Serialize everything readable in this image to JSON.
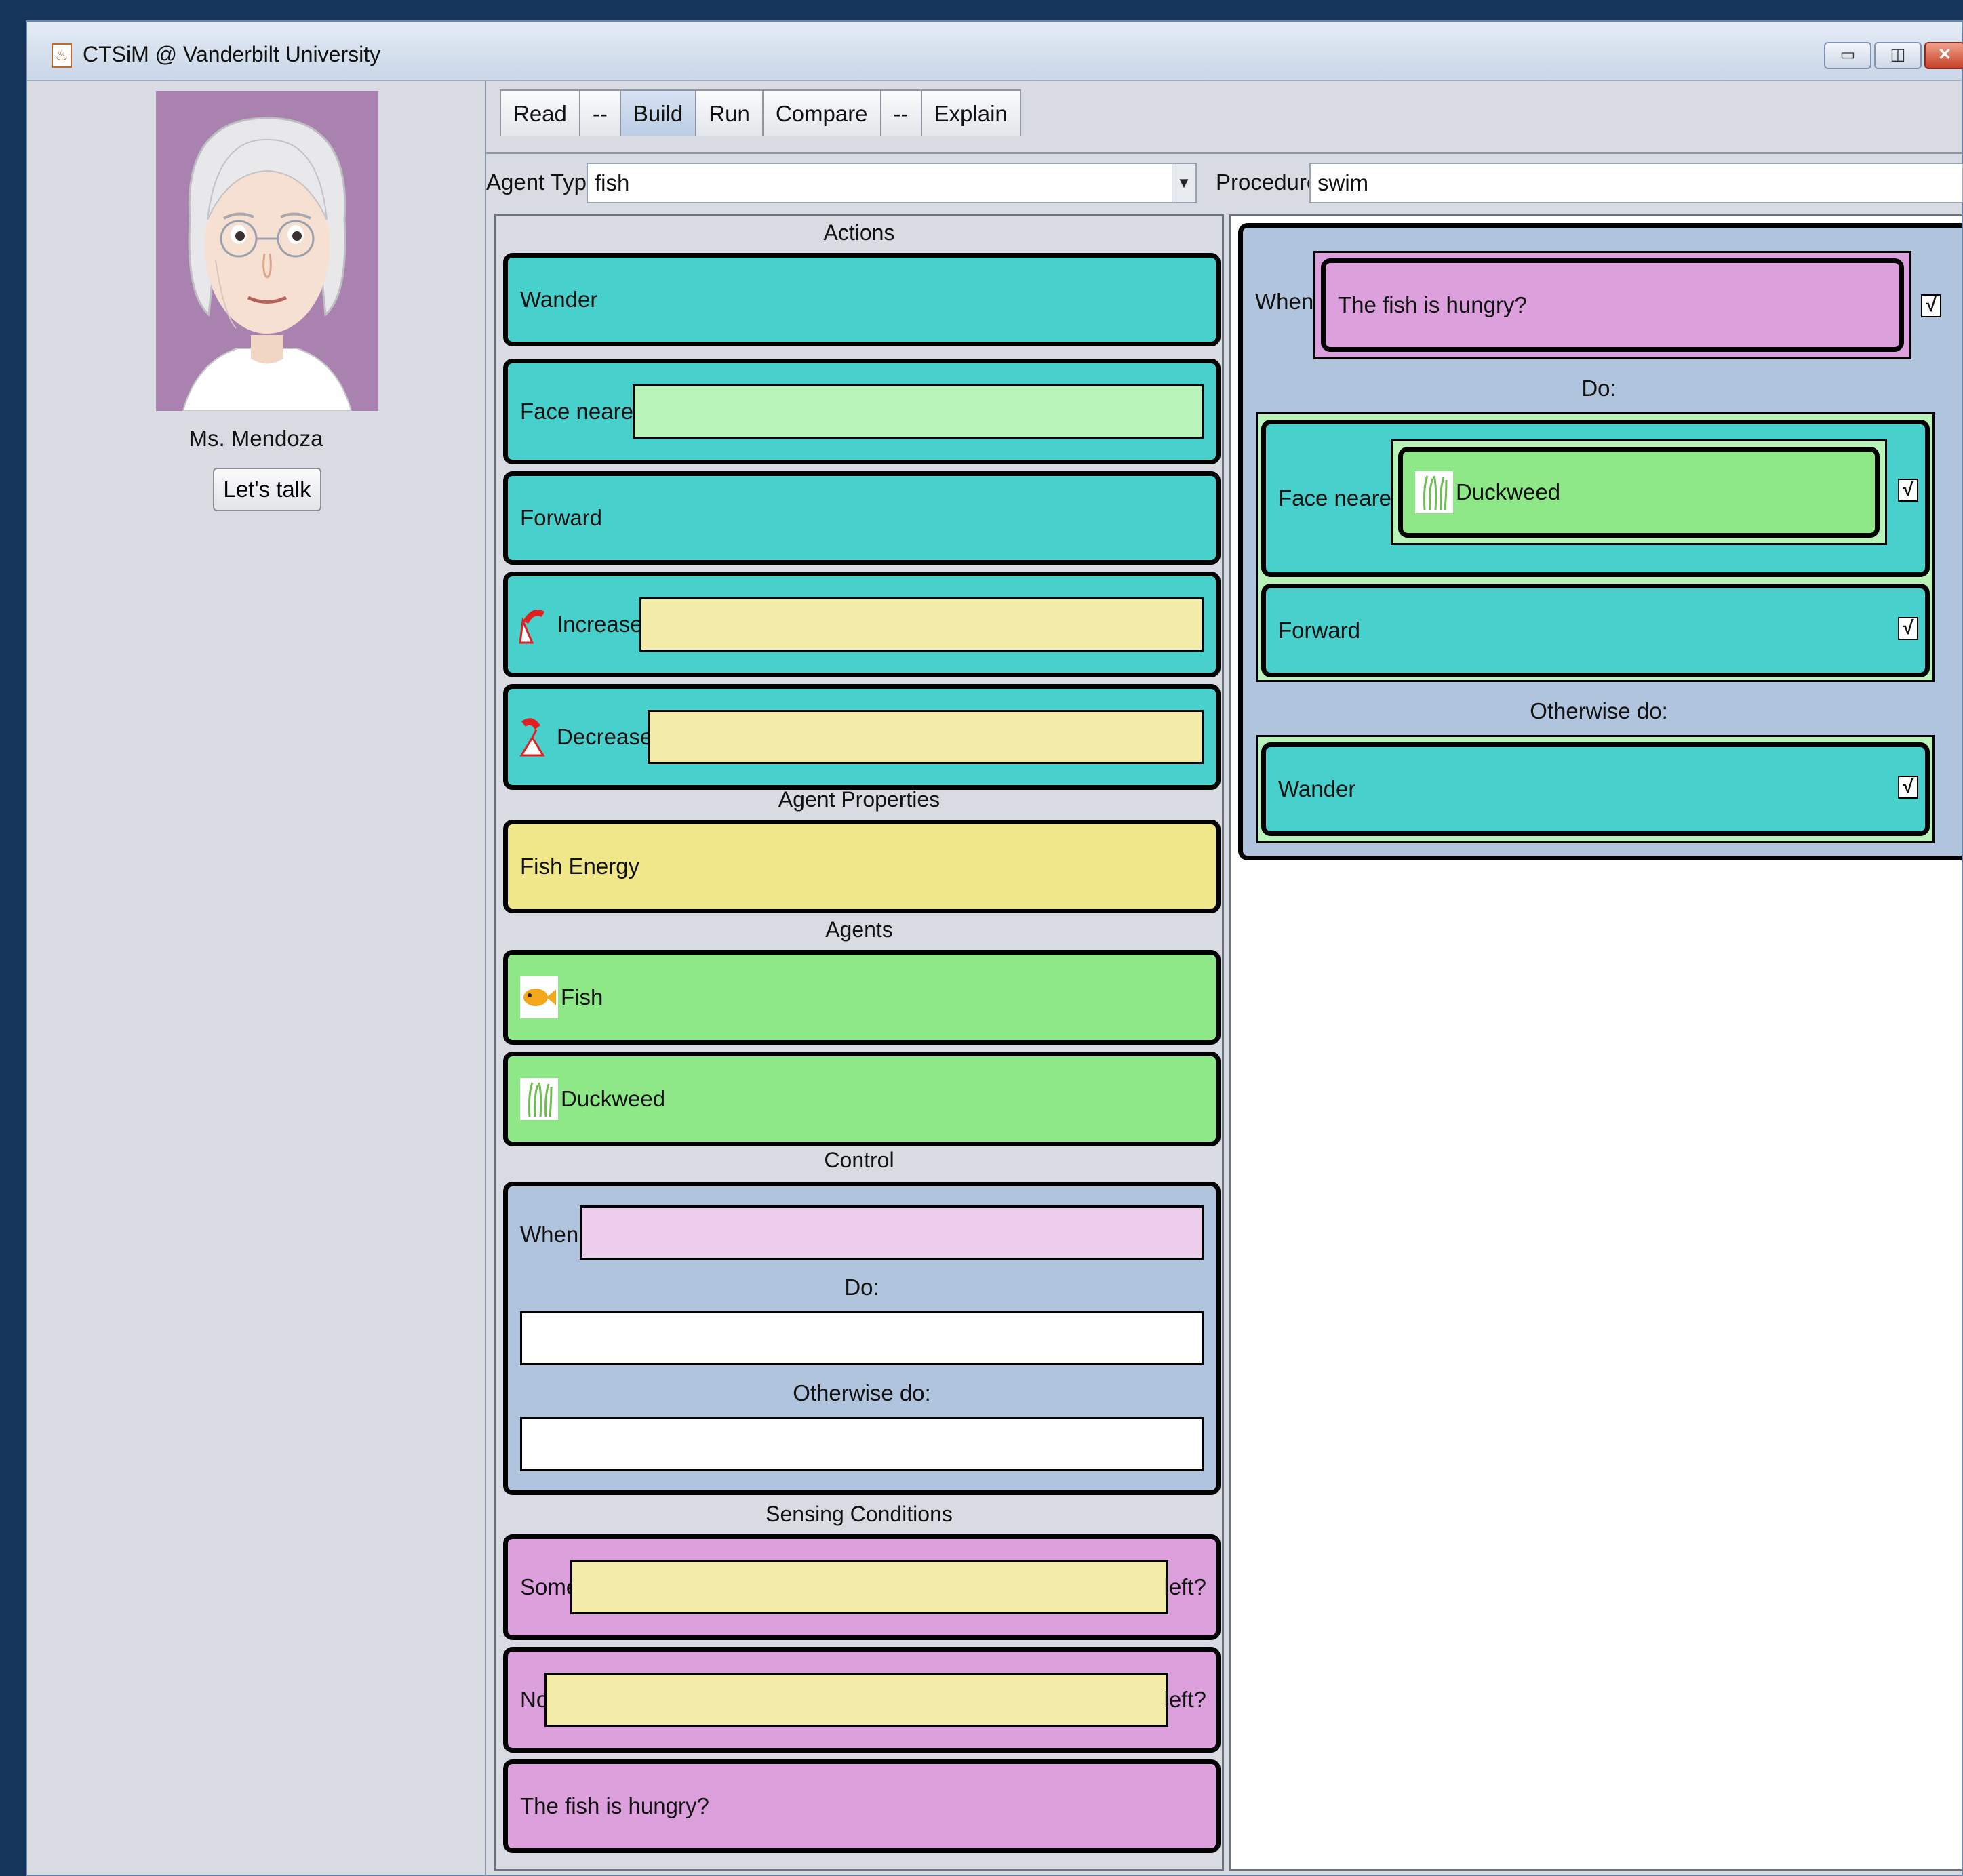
{
  "window": {
    "title": "CTSiM @ Vanderbilt University",
    "controls": [
      "minimize-icon",
      "maximize-icon",
      "close-icon"
    ]
  },
  "teacher": {
    "name": "Ms. Mendoza",
    "talk_button": "Let's talk"
  },
  "tabs": [
    {
      "label": "Read"
    },
    {
      "label": "--"
    },
    {
      "label": "Build",
      "active": true
    },
    {
      "label": "Run"
    },
    {
      "label": "Compare"
    },
    {
      "label": "--"
    },
    {
      "label": "Explain"
    }
  ],
  "agent_type": {
    "label": "Agent Type:",
    "value": "fish"
  },
  "procedure": {
    "label": "Procedure:",
    "value": "swim"
  },
  "palette": {
    "actions_title": "Actions",
    "actions": {
      "wander": "Wander",
      "face_nearest": "Face nearest",
      "forward": "Forward",
      "increase": "Increase",
      "decrease": "Decrease"
    },
    "agent_properties_title": "Agent Properties",
    "agent_properties": {
      "fish_energy": "Fish Energy"
    },
    "agents_title": "Agents",
    "agents": {
      "fish": "Fish",
      "duckweed": "Duckweed"
    },
    "control_title": "Control",
    "control": {
      "when": "When:",
      "do": "Do:",
      "otherwise": "Otherwise do:"
    },
    "sensing_title": "Sensing Conditions",
    "sensing": {
      "some": "Some",
      "no": "No",
      "left": "left?",
      "hungry": "The fish is hungry?"
    }
  },
  "program": {
    "when_label": "When:",
    "condition": "The fish is hungry?",
    "do_label": "Do:",
    "face_nearest": "Face nearest",
    "target": "Duckweed",
    "forward": "Forward",
    "otherwise_label": "Otherwise do:",
    "wander": "Wander",
    "check_mark": "√"
  },
  "colors": {
    "action_teal": "#48d0cc",
    "property_yellow": "#f0e68a",
    "agent_green": "#8fe887",
    "sensing_pink": "#dca0dc",
    "control_blue": "#b0c4de",
    "avatar_bg": "#a982b0"
  }
}
